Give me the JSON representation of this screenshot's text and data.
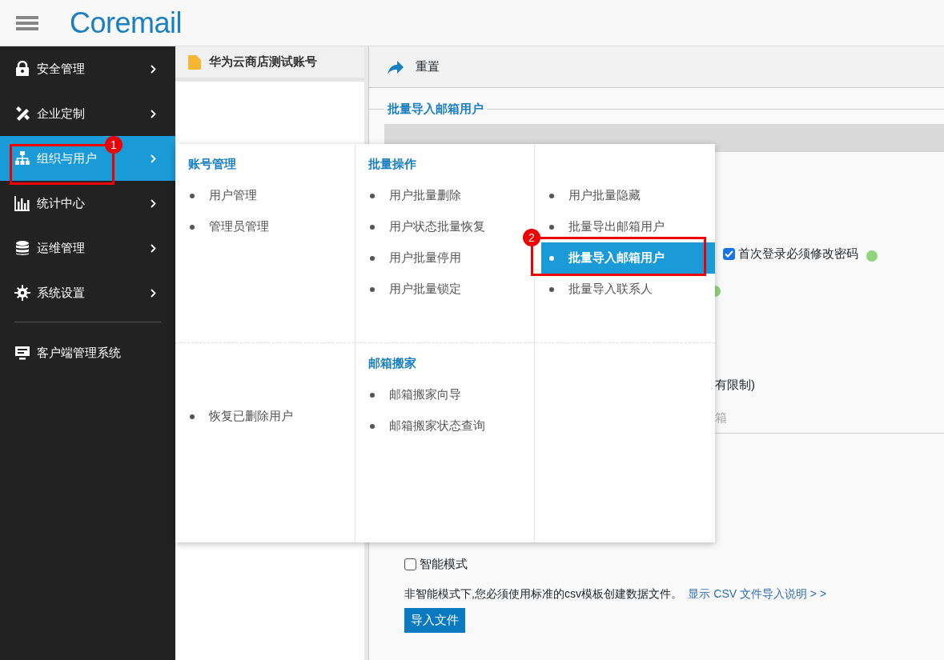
{
  "header": {
    "logo": "Coremail"
  },
  "sidebar": {
    "items": [
      {
        "label": "安全管理",
        "selected": false,
        "expandable": true
      },
      {
        "label": "企业定制",
        "selected": false,
        "expandable": true
      },
      {
        "label": "组织与用户",
        "selected": true,
        "expandable": true,
        "callout": "1"
      },
      {
        "label": "统计中心",
        "selected": false,
        "expandable": true
      },
      {
        "label": "运维管理",
        "selected": false,
        "expandable": true
      },
      {
        "label": "系统设置",
        "selected": false,
        "expandable": true
      },
      {
        "label": "客户端管理系统",
        "selected": false,
        "expandable": false
      }
    ]
  },
  "account_pane": {
    "title": "华为云商店测试账号"
  },
  "content": {
    "reset": "重置",
    "legend": "批量导入邮箱用户",
    "first_login": {
      "label": "首次登录必须修改密码",
      "checked": true
    },
    "fragment_1": "有限制)",
    "fragment_2": "箱",
    "smart_mode": {
      "label": "智能模式",
      "checked": false
    },
    "note": "非智能模式下,您必须使用标准的csv模板创建数据文件。",
    "link": "显示 CSV 文件导入说明 > >",
    "import_button": "导入文件"
  },
  "mega_menu": {
    "rows": [
      {
        "columns": [
          {
            "heading": "账号管理",
            "items": [
              {
                "label": "用户管理",
                "selected": false
              },
              {
                "label": "管理员管理",
                "selected": false
              }
            ]
          },
          {
            "heading": "批量操作",
            "items": [
              {
                "label": "用户批量删除",
                "selected": false
              },
              {
                "label": "用户状态批量恢复",
                "selected": false
              },
              {
                "label": "用户批量停用",
                "selected": false
              },
              {
                "label": "用户批量锁定",
                "selected": false
              }
            ]
          },
          {
            "items": [
              {
                "label": "用户批量隐藏",
                "selected": false
              },
              {
                "label": "批量导出邮箱用户",
                "selected": false
              },
              {
                "label": "批量导入邮箱用户",
                "selected": true,
                "callout": "2"
              },
              {
                "label": "批量导入联系人",
                "selected": false
              }
            ]
          }
        ]
      },
      {
        "columns": [
          {
            "items": [
              {
                "label": "恢复已删除用户",
                "selected": false
              }
            ]
          },
          {
            "heading": "邮箱搬家",
            "items": [
              {
                "label": "邮箱搬家向导",
                "selected": false
              },
              {
                "label": "邮箱搬家状态查询",
                "selected": false
              }
            ]
          },
          {}
        ]
      }
    ]
  }
}
